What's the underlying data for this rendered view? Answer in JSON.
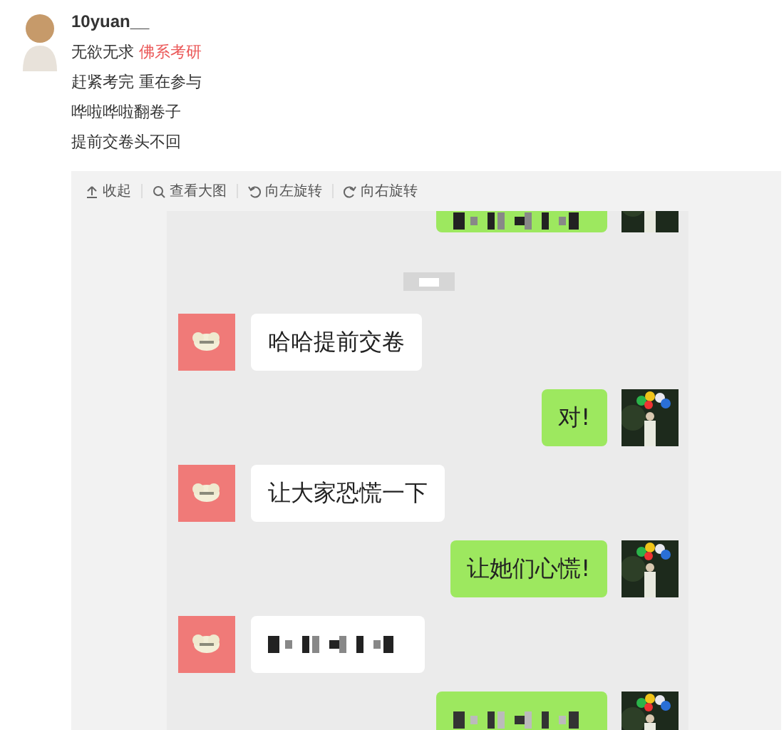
{
  "post": {
    "username": "10yuan__",
    "lines": [
      {
        "text": "无欲无求",
        "topic": "佛系考研"
      },
      {
        "text": "赶紧考完 重在参与"
      },
      {
        "text": "哗啦哗啦翻卷子"
      },
      {
        "text": "提前交卷头不回"
      }
    ]
  },
  "toolbar": [
    {
      "label": "收起"
    },
    {
      "label": "查看大图"
    },
    {
      "label": "向左旋转"
    },
    {
      "label": "向右旋转"
    }
  ],
  "chat": [
    {
      "kind": "outgoing"
    },
    {
      "kind": "timestamp"
    },
    {
      "kind": "incoming",
      "text": "哈哈提前交卷"
    },
    {
      "kind": "outgoing",
      "text": "对!"
    },
    {
      "kind": "incoming",
      "text": "让大家恐慌一下"
    },
    {
      "kind": "outgoing",
      "text": "让她们心慌!"
    },
    {
      "kind": "incoming"
    },
    {
      "kind": "outgoing"
    }
  ]
}
